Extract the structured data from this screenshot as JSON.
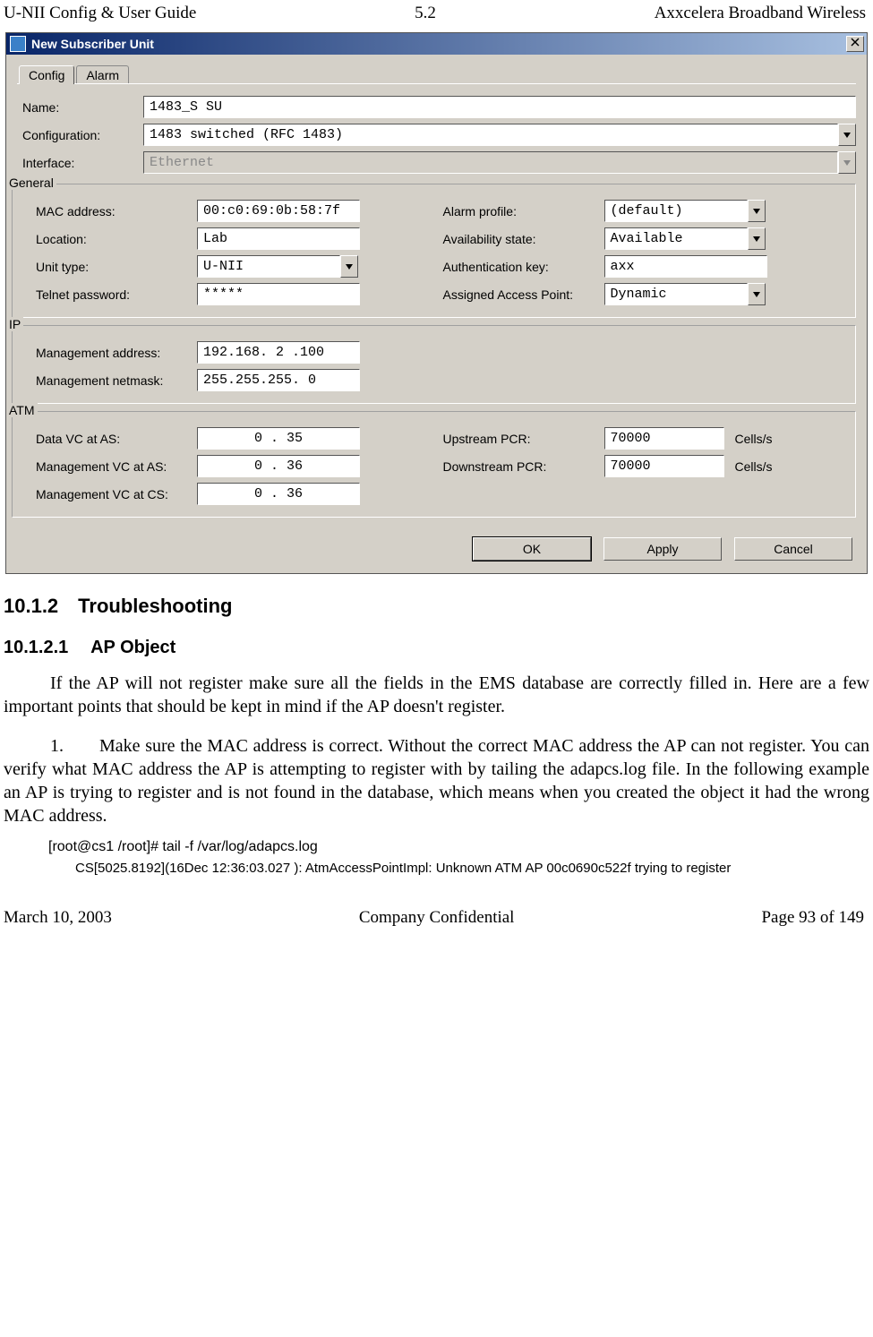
{
  "header": {
    "left": "U-NII Config & User Guide",
    "center": "5.2",
    "right": "Axxcelera Broadband Wireless"
  },
  "dialog": {
    "title": "New Subscriber Unit",
    "close": "X",
    "tabs": {
      "config": "Config",
      "alarm": "Alarm"
    },
    "fields": {
      "name_lbl": "Name:",
      "name_val": "1483_S SU",
      "config_lbl": "Configuration:",
      "config_val": "1483 switched (RFC 1483)",
      "iface_lbl": "Interface:",
      "iface_val": "Ethernet"
    },
    "general": {
      "legend": "General",
      "mac_lbl": "MAC address:",
      "mac_val": "00:c0:69:0b:58:7f",
      "loc_lbl": "Location:",
      "loc_val": "Lab",
      "unit_lbl": "Unit type:",
      "unit_val": "U-NII",
      "telnet_lbl": "Telnet password:",
      "telnet_val": "*****",
      "alarm_lbl": "Alarm profile:",
      "alarm_val": "(default)",
      "avail_lbl": "Availability state:",
      "avail_val": "Available",
      "auth_lbl": "Authentication key:",
      "auth_val": "axx",
      "ap_lbl": "Assigned Access Point:",
      "ap_val": "Dynamic"
    },
    "ip": {
      "legend": "IP",
      "addr_lbl": "Management address:",
      "addr_val": "192.168. 2 .100",
      "mask_lbl": "Management netmask:",
      "mask_val": "255.255.255. 0"
    },
    "atm": {
      "legend": "ATM",
      "dataas_lbl": "Data VC at AS:",
      "dataas_val": " 0  .  35",
      "mgmtas_lbl": "Management VC at AS:",
      "mgmtas_val": " 0  .  36",
      "mgmtcs_lbl": "Management VC at CS:",
      "mgmtcs_val": " 0  .  36",
      "up_lbl": "Upstream PCR:",
      "up_val": "70000",
      "dn_lbl": "Downstream PCR:",
      "dn_val": "70000",
      "unit": "Cells/s"
    },
    "buttons": {
      "ok": "OK",
      "apply": "Apply",
      "cancel": "Cancel"
    }
  },
  "text": {
    "h2": "10.1.2 Troubleshooting",
    "h3": "10.1.2.1  AP Object",
    "p1": "If the AP will not register make sure all the fields in the EMS database are correctly filled in. Here are a few important points that should be kept in mind if the AP doesn't register.",
    "p2": "1.  Make sure the MAC address is correct.  Without the correct MAC address the AP can not register. You can verify what MAC address the AP is attempting to register with by tailing the adapcs.log file. In the following example an AP is trying to register and is not found in the database, which means when you created the object it had the wrong MAC address.",
    "code1": "[root@cs1 /root]#   tail   -f   /var/log/adapcs.log",
    "code2": "CS[5025.8192](16Dec 12:36:03.027 ): AtmAccessPointImpl: Unknown ATM AP 00c0690c522f trying to register"
  },
  "footer": {
    "left": "March 10, 2003",
    "center": "Company Confidential",
    "right": "Page 93 of 149"
  }
}
